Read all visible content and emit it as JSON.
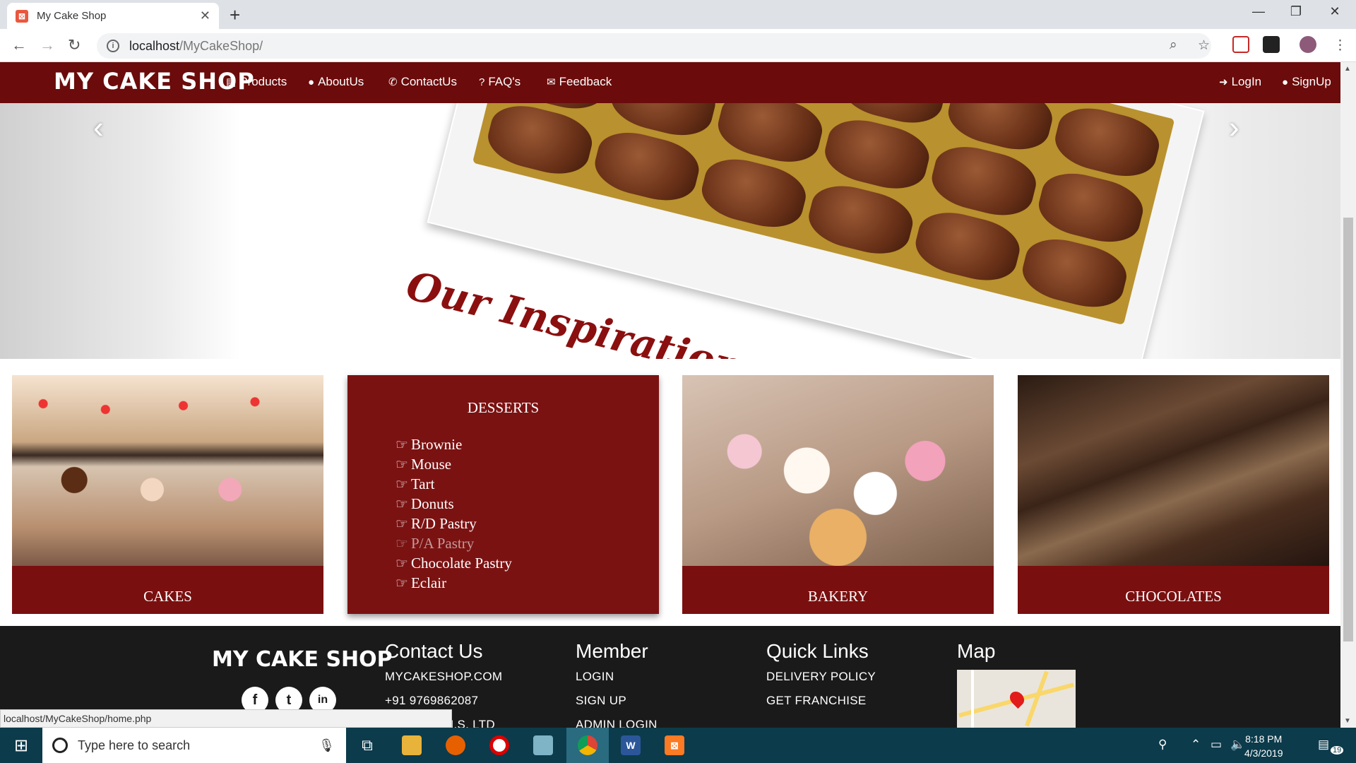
{
  "browser": {
    "tab_title": "My Cake Shop",
    "url_host": "localhost",
    "url_path": "/MyCakeShop/",
    "status_url": "localhost/MyCakeShop/home.php"
  },
  "nav": {
    "logo": "MY CAKE SHOP",
    "links": [
      "Products",
      "AboutUs",
      "ContactUs",
      "FAQ's",
      "Feedback"
    ],
    "login": "LogIn",
    "signup": "SignUp"
  },
  "carousel": {
    "caption": "Our Inspiration Comes From ..."
  },
  "cards": {
    "cakes": "CAKES",
    "bakery": "BAKERY",
    "chocolates": "CHOCOLATES",
    "desserts_title": "DESSERTS",
    "desserts": [
      "Brownie",
      "Mouse",
      "Tart",
      "Donuts",
      "R/D Pastry",
      "P/A Pastry",
      "Chocolate Pastry",
      "Eclair"
    ]
  },
  "footer": {
    "logo": "MY CAKE SHOP",
    "contact_title": "Contact Us",
    "contact": [
      "MYCAKESHOP.COM",
      "+91 9769862087",
      "B, NEW C.H.S. LTD"
    ],
    "member_title": "Member",
    "member": [
      "LOGIN",
      "SIGN UP",
      "ADMIN LOGIN"
    ],
    "quick_title": "Quick Links",
    "quick": [
      "DELIVERY POLICY",
      "GET FRANCHISE"
    ],
    "map_title": "Map"
  },
  "taskbar": {
    "search_placeholder": "Type here to search",
    "time": "8:18 PM",
    "date": "4/3/2019",
    "notifications": "19"
  }
}
